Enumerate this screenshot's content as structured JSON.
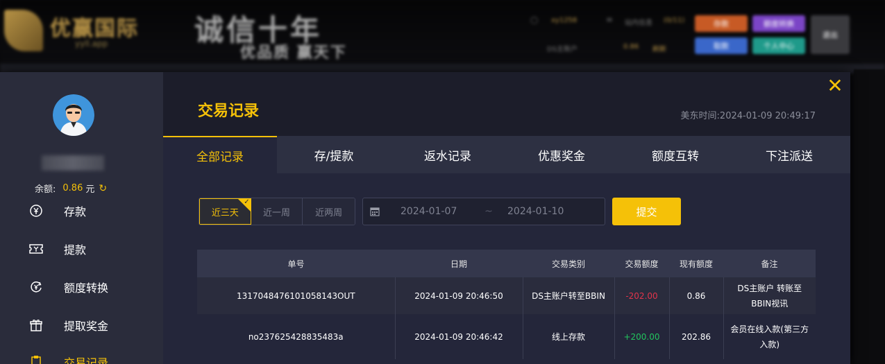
{
  "background": {
    "logo_name": "优赢国际",
    "logo_domain": "yyll.app",
    "slogan_main": "诚信十年",
    "slogan_sub": "优品质  赢天下",
    "user_name": "xy1258",
    "msg_label": "站内信息",
    "msg_count": "(0/11)",
    "main_account_label": "DS主账户",
    "main_account_value": "0.86",
    "refresh_label": "刷新",
    "btn_deposit": "存款",
    "btn_fund": "额度转换",
    "btn_withdraw": "取款",
    "btn_center": "个人中心",
    "btn_logout": "退出"
  },
  "sidebar": {
    "balance_label": "余额:",
    "balance_value": "0.86",
    "balance_unit": "元",
    "items": [
      {
        "label": "存款"
      },
      {
        "label": "提款"
      },
      {
        "label": "额度转换"
      },
      {
        "label": "提取奖金"
      },
      {
        "label": "交易记录"
      }
    ]
  },
  "header": {
    "title": "交易记录",
    "time_label": "美东时间:",
    "time_value": "2024-01-09 20:49:17"
  },
  "tabs": [
    {
      "label": "全部记录",
      "active": true
    },
    {
      "label": "存/提款"
    },
    {
      "label": "返水记录"
    },
    {
      "label": "优惠奖金"
    },
    {
      "label": "额度互转"
    },
    {
      "label": "下注派送"
    }
  ],
  "filters": {
    "ranges": [
      {
        "label": "近三天",
        "active": true
      },
      {
        "label": "近一周"
      },
      {
        "label": "近两周"
      }
    ],
    "date_from": "2024-01-07",
    "date_sep": "~",
    "date_to": "2024-01-10",
    "submit_label": "提交"
  },
  "table": {
    "headers": [
      "单号",
      "日期",
      "交易类别",
      "交易额度",
      "现有额度",
      "备注"
    ],
    "rows": [
      {
        "id": "1317048476101058143OUT",
        "date": "2024-01-09 20:46:50",
        "type": "DS主账户转至BBIN",
        "amount": "-202.00",
        "balance": "0.86",
        "note": "DS主账户 转账至 BBIN视讯"
      },
      {
        "id": "no237625428835483a",
        "date": "2024-01-09 20:46:42",
        "type": "线上存款",
        "amount": "+200.00",
        "balance": "202.86",
        "note": "会员在线入款(第三方入款)"
      }
    ]
  },
  "colors": {
    "accent": "#f5c108",
    "negative": "#e2344b",
    "positive": "#22c55e"
  }
}
